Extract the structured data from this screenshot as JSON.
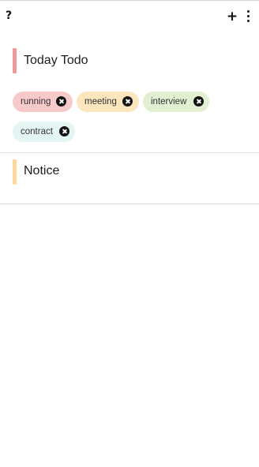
{
  "toolbar": {
    "help_label": "?",
    "add_label": "+",
    "more_icon": "more-vertical-icon"
  },
  "today": {
    "title": "Today Todo",
    "accent": "#ef9a9a",
    "tags": [
      {
        "label": "running",
        "color": "#f7caca"
      },
      {
        "label": "meeting",
        "color": "#fce6bd"
      },
      {
        "label": "interview",
        "color": "#e2efd1"
      },
      {
        "label": "contract",
        "color": "#e4f6f3"
      }
    ]
  },
  "notice": {
    "title": "Notice",
    "accent": "#fdd9a0"
  }
}
